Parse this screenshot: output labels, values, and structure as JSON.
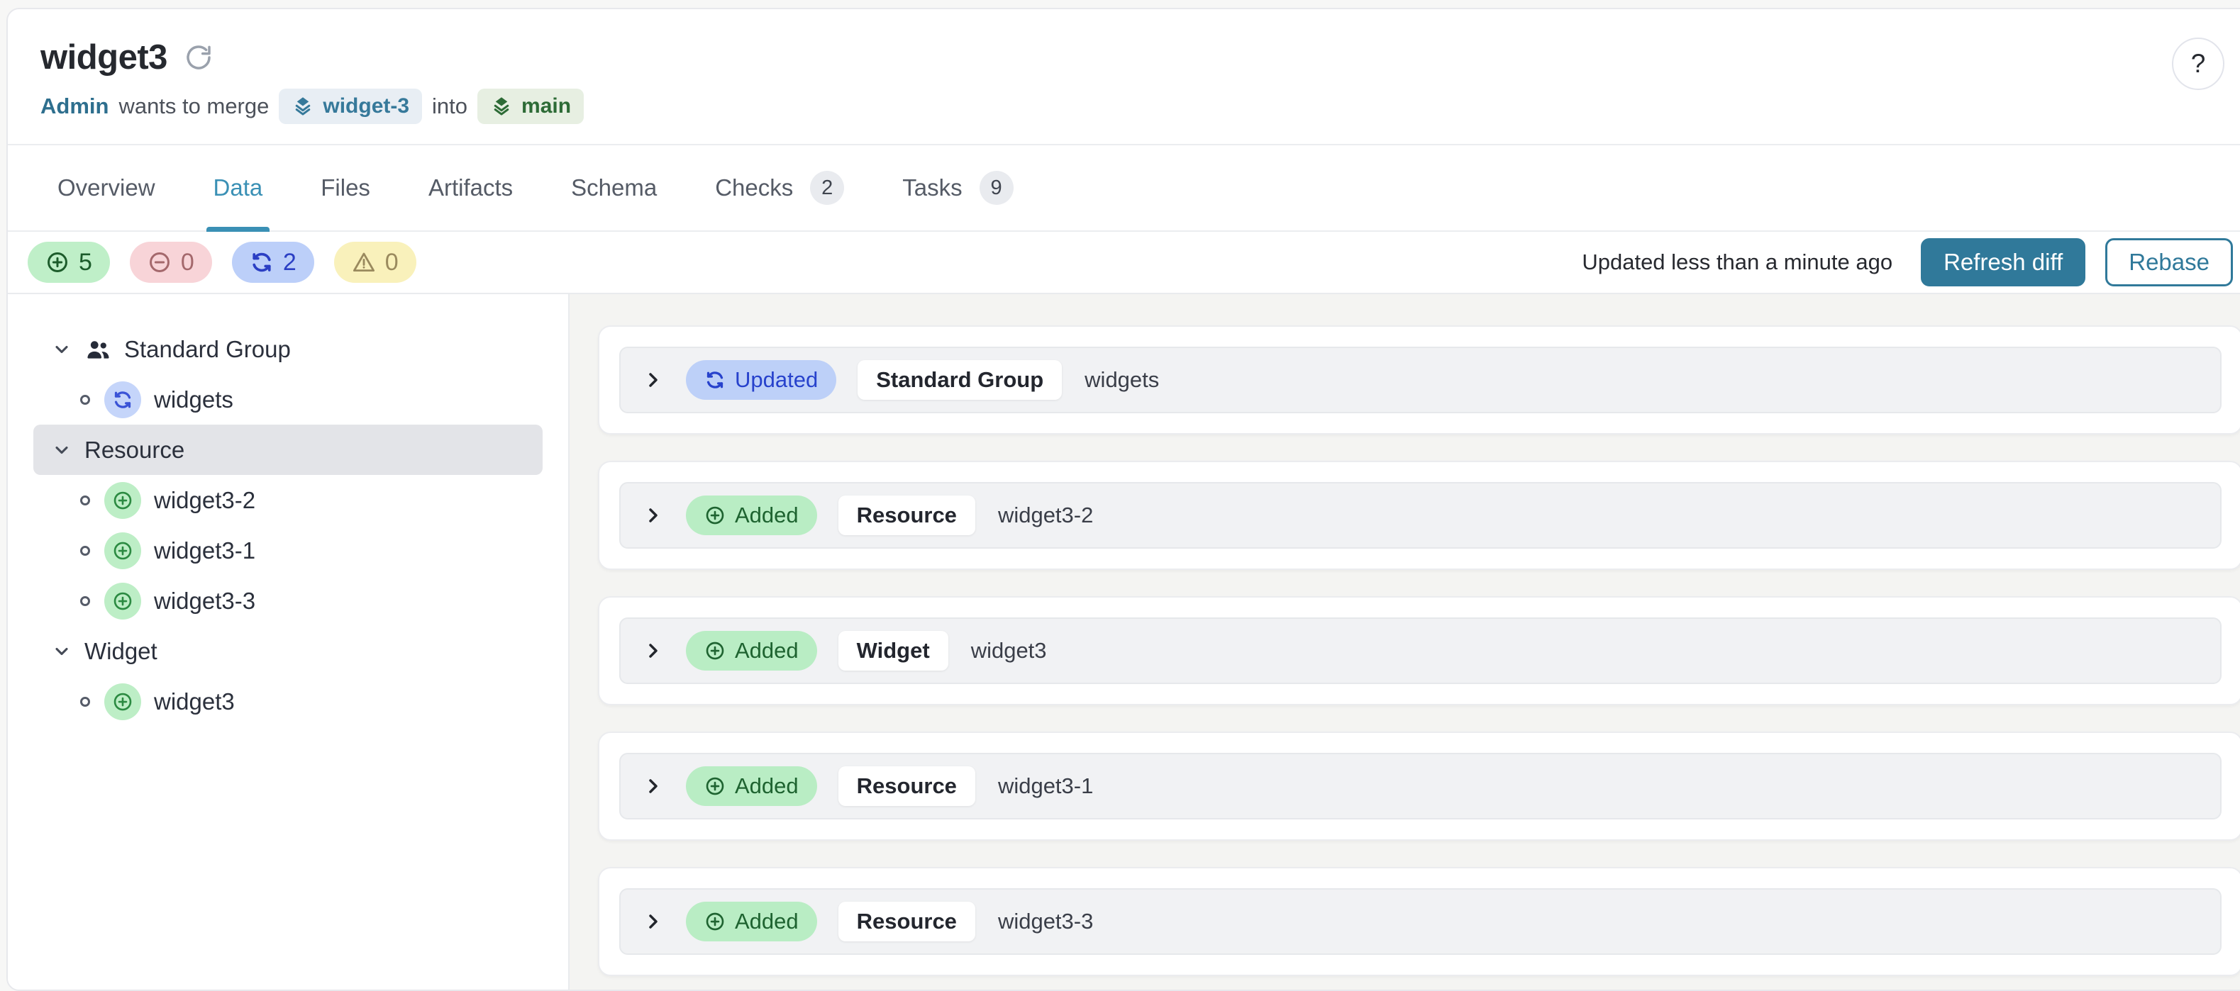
{
  "header": {
    "title": "widget3",
    "author": "Admin",
    "merge_text": "wants to merge",
    "source_branch": "widget-3",
    "into_text": "into",
    "target_branch": "main",
    "help_label": "?"
  },
  "tabs": [
    {
      "label": "Overview"
    },
    {
      "label": "Data",
      "active": true
    },
    {
      "label": "Files"
    },
    {
      "label": "Artifacts"
    },
    {
      "label": "Schema"
    },
    {
      "label": "Checks",
      "count": "2"
    },
    {
      "label": "Tasks",
      "count": "9"
    }
  ],
  "toolbar": {
    "stats": [
      {
        "type": "added",
        "count": "5"
      },
      {
        "type": "removed",
        "count": "0"
      },
      {
        "type": "updated",
        "count": "2"
      },
      {
        "type": "warning",
        "count": "0"
      }
    ],
    "updated_text": "Updated less than a minute ago",
    "refresh_button": "Refresh diff",
    "rebase_button": "Rebase"
  },
  "sidebar": {
    "groups": [
      {
        "label": "Standard Group",
        "icon": "people-icon",
        "children": [
          {
            "label": "widgets",
            "status": "updated"
          }
        ]
      },
      {
        "label": "Resource",
        "selected": true,
        "children": [
          {
            "label": "widget3-2",
            "status": "added"
          },
          {
            "label": "widget3-1",
            "status": "added"
          },
          {
            "label": "widget3-3",
            "status": "added"
          }
        ]
      },
      {
        "label": "Widget",
        "children": [
          {
            "label": "widget3",
            "status": "added"
          }
        ]
      }
    ]
  },
  "diff_rows": [
    {
      "status": "Updated",
      "type": "Standard Group",
      "name": "widgets"
    },
    {
      "status": "Added",
      "type": "Resource",
      "name": "widget3-2"
    },
    {
      "status": "Added",
      "type": "Widget",
      "name": "widget3"
    },
    {
      "status": "Added",
      "type": "Resource",
      "name": "widget3-1"
    },
    {
      "status": "Added",
      "type": "Resource",
      "name": "widget3-3"
    }
  ],
  "colors": {
    "accent": "#30799a",
    "tab-active": "#3a90b5",
    "added-bg": "#bfefc8",
    "added-text": "#1c5c2b",
    "removed-bg": "#f8d4d8",
    "removed-text": "#a4686c",
    "updated-bg": "#bccff9",
    "updated-text": "#2b3fc4",
    "warn-bg": "#f9f1bb",
    "warn-text": "#9a8a5e",
    "branch-src-bg": "#e8eef4",
    "branch-src-text": "#36799a",
    "branch-tgt-bg": "#e7efe2",
    "branch-tgt-text": "#2d6b36",
    "badge-updated-bg": "#c5d5fa",
    "badge-updated-icon": "#3a53d6",
    "badge-added-bg": "#bdeec6",
    "badge-added-icon": "#2b8a41",
    "pill-updated-bg": "#bdd0f8",
    "pill-updated-text": "#2742cc",
    "pill-added-bg": "#b9edc4",
    "pill-added-text": "#1e6330"
  }
}
